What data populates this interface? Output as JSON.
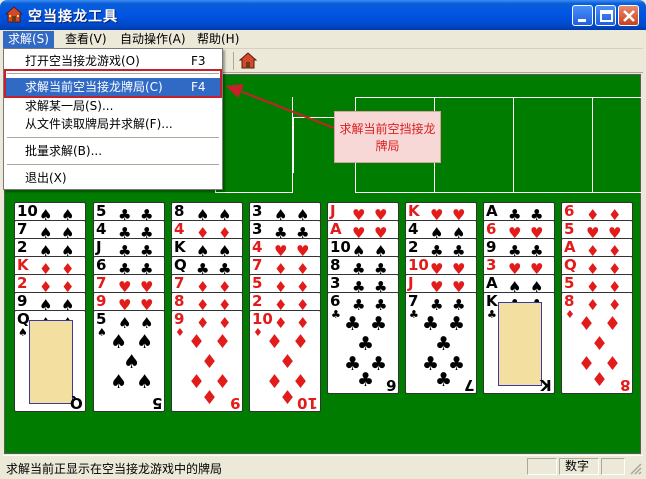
{
  "window": {
    "title": "空当接龙工具",
    "icon": "house-icon",
    "controls": [
      "minimize-icon",
      "maximize-icon",
      "close-icon"
    ]
  },
  "menubar": {
    "items": [
      {
        "label": "求解(S)"
      },
      {
        "label": "查看(V)"
      },
      {
        "label": "自动操作(A)"
      },
      {
        "label": "帮助(H)"
      }
    ]
  },
  "dropdown": {
    "items": [
      {
        "label": "打开空当接龙游戏(O)",
        "key": "F3"
      },
      {
        "label": "求解当前空当接龙牌局(C)",
        "key": "F4"
      },
      {
        "label": "求解某一局(S)...",
        "key": ""
      },
      {
        "label": "从文件读取牌局并求解(F)...",
        "key": ""
      },
      {
        "label": "批量求解(B)...",
        "key": ""
      },
      {
        "label": "退出(X)",
        "key": ""
      }
    ]
  },
  "callout": {
    "line1": "求解当前空挡接龙",
    "line2": "牌局"
  },
  "columns": [
    [
      {
        "r": "10",
        "s": "♠"
      },
      {
        "r": "7",
        "s": "♠"
      },
      {
        "r": "2",
        "s": "♠"
      },
      {
        "r": "K",
        "s": "♦"
      },
      {
        "r": "2",
        "s": "♦"
      },
      {
        "r": "9",
        "s": "♠"
      },
      {
        "r": "Q",
        "s": "♠"
      }
    ],
    [
      {
        "r": "5",
        "s": "♣"
      },
      {
        "r": "4",
        "s": "♣"
      },
      {
        "r": "J",
        "s": "♣"
      },
      {
        "r": "6",
        "s": "♣"
      },
      {
        "r": "7",
        "s": "♥"
      },
      {
        "r": "9",
        "s": "♥"
      },
      {
        "r": "5",
        "s": "♠"
      }
    ],
    [
      {
        "r": "8",
        "s": "♠"
      },
      {
        "r": "4",
        "s": "♦"
      },
      {
        "r": "K",
        "s": "♠"
      },
      {
        "r": "Q",
        "s": "♣"
      },
      {
        "r": "7",
        "s": "♦"
      },
      {
        "r": "8",
        "s": "♦"
      },
      {
        "r": "9",
        "s": "♦"
      }
    ],
    [
      {
        "r": "3",
        "s": "♠"
      },
      {
        "r": "3",
        "s": "♣"
      },
      {
        "r": "4",
        "s": "♥"
      },
      {
        "r": "7",
        "s": "♦"
      },
      {
        "r": "5",
        "s": "♦"
      },
      {
        "r": "2",
        "s": "♦"
      },
      {
        "r": "10",
        "s": "♦"
      }
    ],
    [
      {
        "r": "J",
        "s": "♥"
      },
      {
        "r": "A",
        "s": "♥"
      },
      {
        "r": "10",
        "s": "♠"
      },
      {
        "r": "8",
        "s": "♣"
      },
      {
        "r": "3",
        "s": "♣"
      },
      {
        "r": "6",
        "s": "♣"
      }
    ],
    [
      {
        "r": "K",
        "s": "♥"
      },
      {
        "r": "4",
        "s": "♠"
      },
      {
        "r": "2",
        "s": "♣"
      },
      {
        "r": "10",
        "s": "♥"
      },
      {
        "r": "J",
        "s": "♥"
      },
      {
        "r": "7",
        "s": "♣"
      }
    ],
    [
      {
        "r": "A",
        "s": "♣"
      },
      {
        "r": "6",
        "s": "♥"
      },
      {
        "r": "9",
        "s": "♣"
      },
      {
        "r": "3",
        "s": "♥"
      },
      {
        "r": "A",
        "s": "♠"
      },
      {
        "r": "K",
        "s": "♣"
      }
    ],
    [
      {
        "r": "6",
        "s": "♦"
      },
      {
        "r": "5",
        "s": "♥"
      },
      {
        "r": "A",
        "s": "♦"
      },
      {
        "r": "Q",
        "s": "♦"
      },
      {
        "r": "5",
        "s": "♦"
      },
      {
        "r": "8",
        "s": "♦"
      }
    ]
  ],
  "statusbar": {
    "text": "求解当前正显示在空当接龙游戏中的牌局",
    "mode": "数字"
  },
  "colors": {
    "felt": "#007c00",
    "highlight": "#c8202a",
    "red_suit": "#e21b1b"
  }
}
